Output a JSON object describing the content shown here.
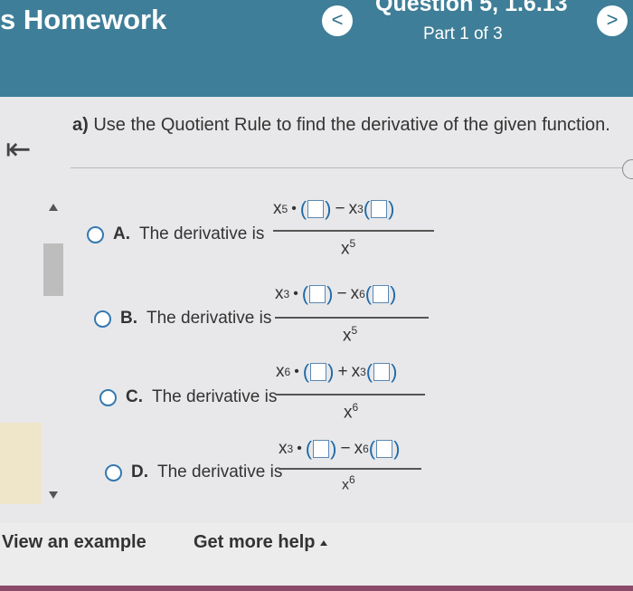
{
  "header": {
    "title": "s Homework",
    "prev_label": "<",
    "next_label": ">",
    "question_title": "Question 5, 1.6.13",
    "part": "Part 1 of 3"
  },
  "question": {
    "prompt_letter": "a)",
    "prompt_text": "Use the Quotient Rule to find the derivative of the given function."
  },
  "options": [
    {
      "letter": "A.",
      "text": "The derivative is",
      "t1": "x",
      "e1": "5",
      "op": "−",
      "t2": "x",
      "e2": "3",
      "den": "x",
      "dene": "5"
    },
    {
      "letter": "B.",
      "text": "The derivative is",
      "t1": "x",
      "e1": "3",
      "op": "−",
      "t2": "x",
      "e2": "6",
      "den": "x",
      "dene": "5"
    },
    {
      "letter": "C.",
      "text": "The derivative is",
      "t1": "x",
      "e1": "6",
      "op": "+",
      "t2": "x",
      "e2": "3",
      "den": "x",
      "dene": "6"
    },
    {
      "letter": "D.",
      "text": "The derivative is",
      "t1": "x",
      "e1": "3",
      "op": "−",
      "t2": "x",
      "e2": "6",
      "den": "x",
      "dene": "6"
    }
  ],
  "footer": {
    "example": "View an example",
    "help": "Get more help"
  },
  "colors": {
    "header_bg": "#3f7e98",
    "radio_border": "#3579b0",
    "answer_box_border": "#5a88b3"
  }
}
